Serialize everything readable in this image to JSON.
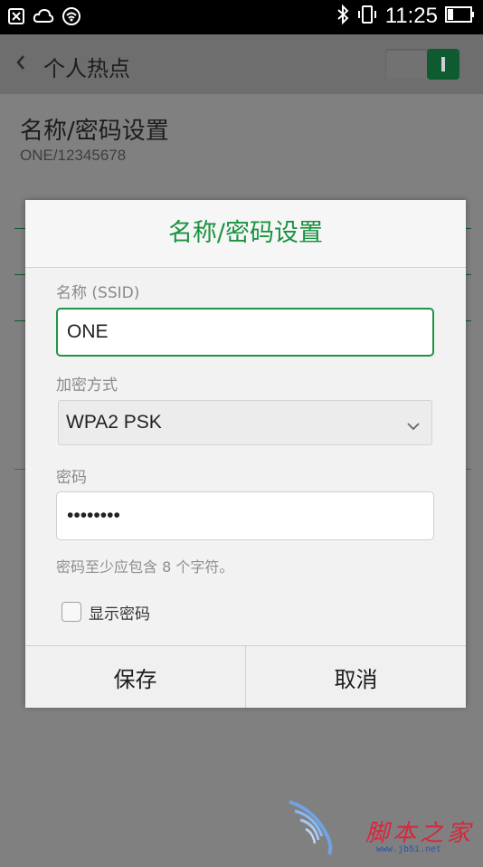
{
  "status_bar": {
    "time": "11:25",
    "left_icons": [
      "sim-card-icon",
      "cloud-icon",
      "signal-radar-icon"
    ],
    "right_icons": [
      "bluetooth-icon",
      "vibrate-icon",
      "battery-icon"
    ]
  },
  "app_bar": {
    "title": "个人热点",
    "hotspot_toggle_on": true
  },
  "background": {
    "setting_title": "名称/密码设置",
    "setting_summary": "ONE/12345678"
  },
  "dialog": {
    "title": "名称/密码设置",
    "ssid_label": "名称 (SSID)",
    "ssid_value": "ONE",
    "security_label": "加密方式",
    "security_value": "WPA2 PSK",
    "password_label": "密码",
    "password_value": "12345678",
    "password_hint": "密码至少应包含 8 个字符。",
    "show_password_label": "显示密码",
    "show_password_checked": false,
    "save_label": "保存",
    "cancel_label": "取消"
  },
  "colors": {
    "accent": "#1a9240",
    "toggle_on": "#0f5b31",
    "status_bar": "#000000"
  },
  "watermark": {
    "text": "脚本之家",
    "url": "www.jb51.net"
  }
}
